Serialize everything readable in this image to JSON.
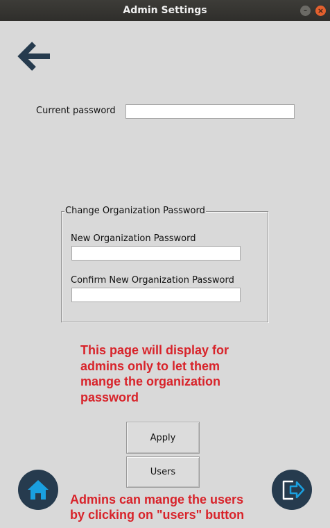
{
  "window": {
    "title": "Admin Settings",
    "minimize_glyph": "–",
    "close_glyph": "×"
  },
  "icons": {
    "back": "arrow-left-icon",
    "home": "home-icon",
    "logout": "logout-icon"
  },
  "current_password": {
    "label": "Current password",
    "value": ""
  },
  "org_group": {
    "title": "Change Organization Password",
    "new_label": "New Organization Password",
    "new_value": "",
    "confirm_label": "Confirm New Organization Password",
    "confirm_value": ""
  },
  "notes": {
    "page_note": [
      "This page will display for",
      "admins only to let them",
      "mange the organization",
      "password"
    ],
    "users_note": [
      "Admins can mange the users",
      "by clicking on \"users\" button"
    ]
  },
  "buttons": {
    "apply": "Apply",
    "users": "Users"
  },
  "colors": {
    "accent_red": "#d8232a",
    "icon_dark": "#263b4e",
    "icon_blue": "#1aa0e0"
  }
}
